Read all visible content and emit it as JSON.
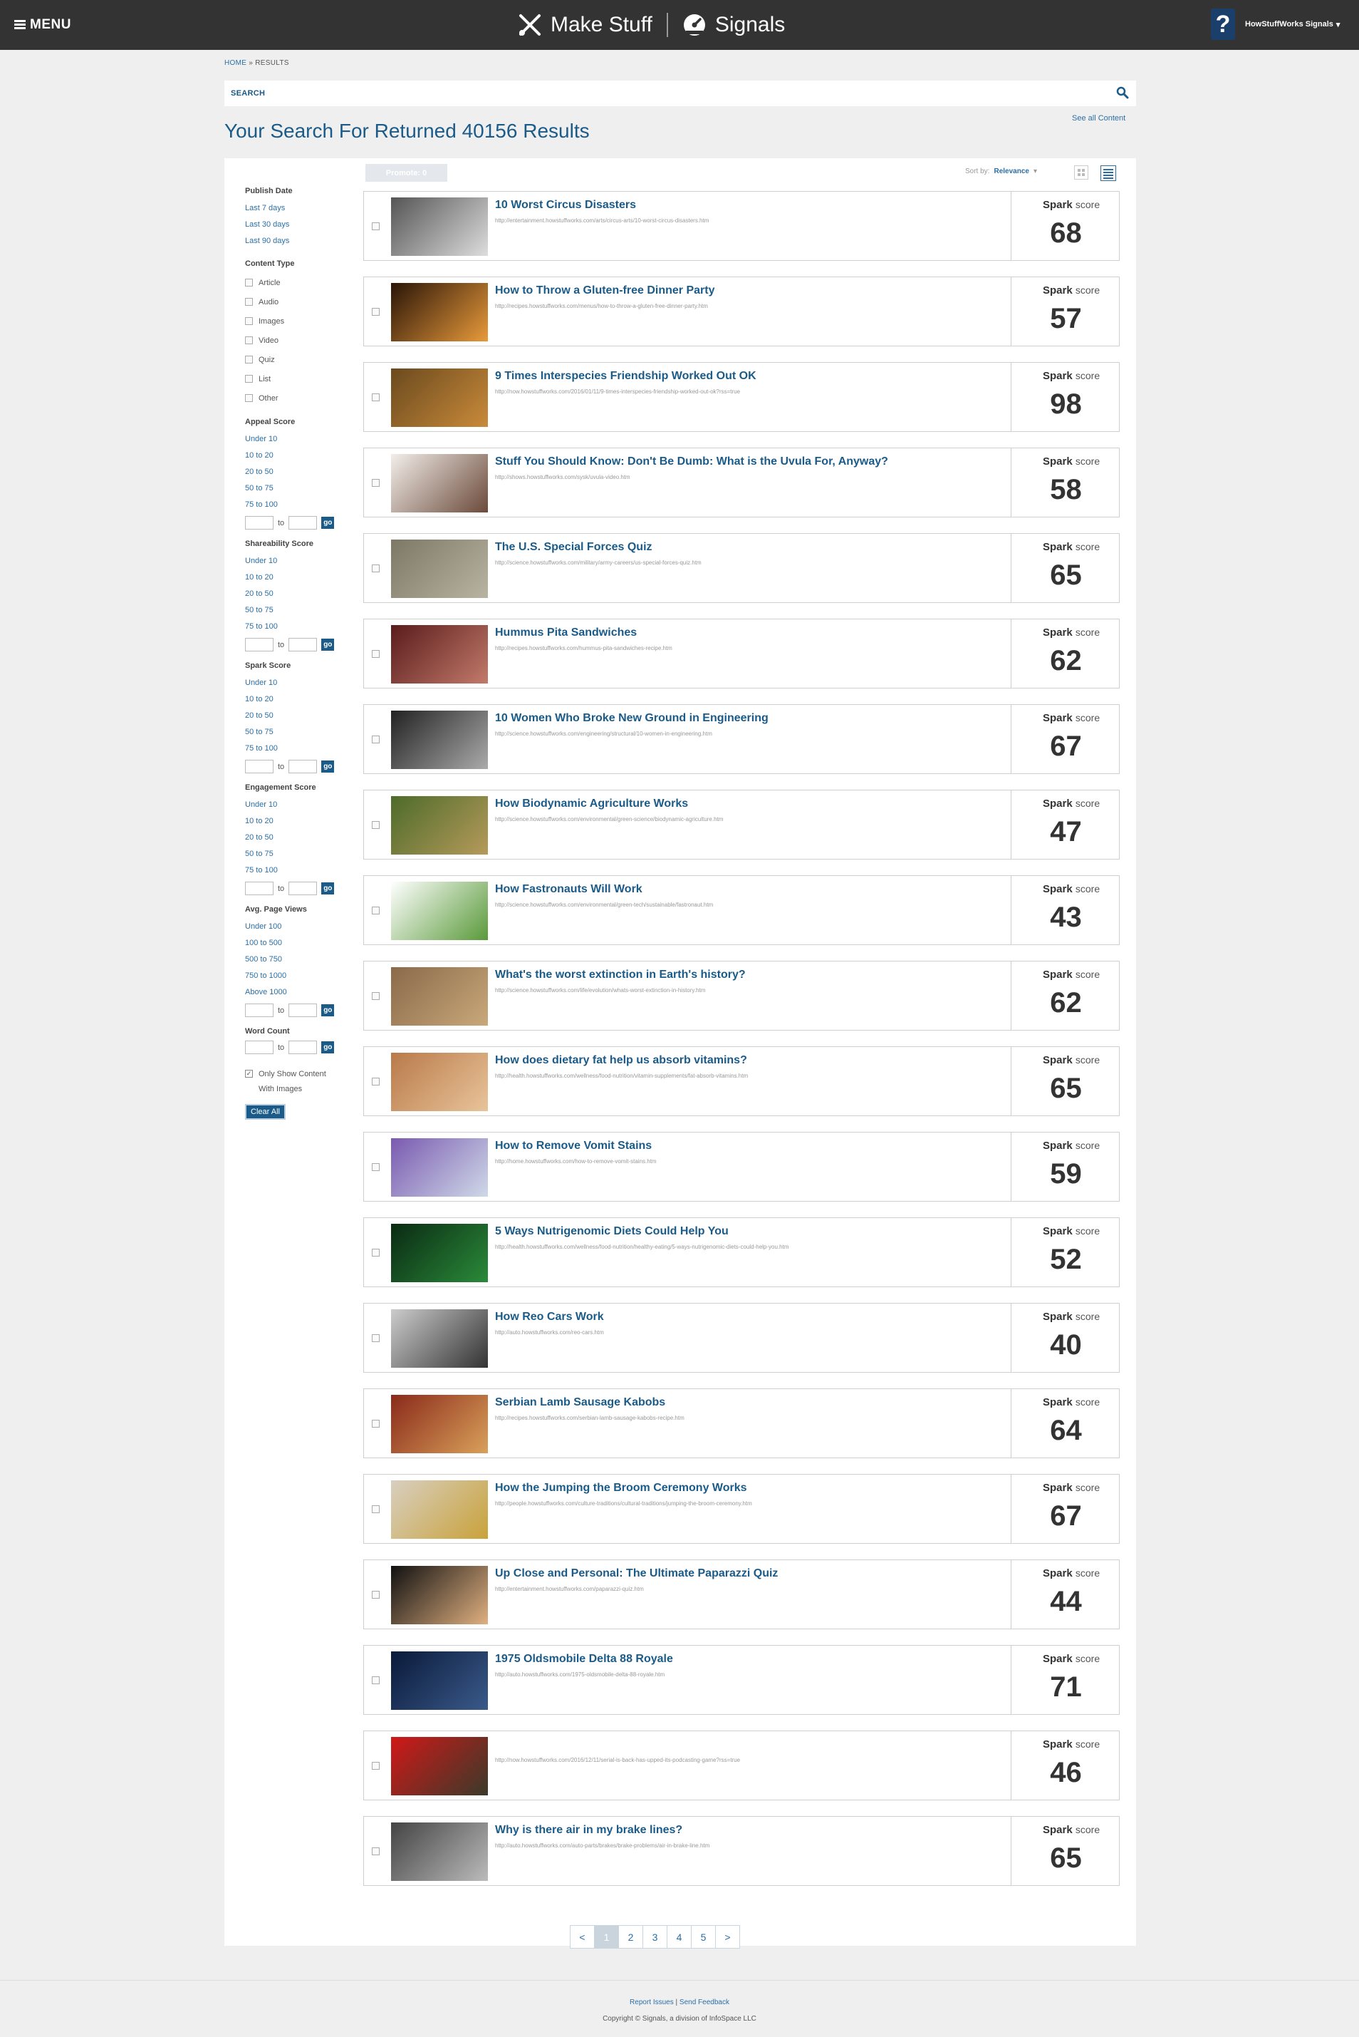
{
  "header": {
    "menu_label": "MENU",
    "brand_left": "Make Stuff",
    "brand_right": "Signals",
    "user_name": "HowStuffWorks Signals"
  },
  "breadcrumb": {
    "home": "HOME",
    "separator": "»",
    "current": "RESULTS"
  },
  "search": {
    "label": "SEARCH"
  },
  "see_all": "See all Content",
  "page_title": "Your Search For Returned 40156 Results",
  "controls": {
    "promote_label": "Promote: 0",
    "sort_label": "Sort by:",
    "sort_value": "Relevance"
  },
  "sidebar": {
    "publish_date": {
      "heading": "Publish Date",
      "options": [
        "Last 7 days",
        "Last 30 days",
        "Last 90 days"
      ]
    },
    "content_type": {
      "heading": "Content Type",
      "options": [
        "Article",
        "Audio",
        "Images",
        "Video",
        "Quiz",
        "List",
        "Other"
      ]
    },
    "appeal": {
      "heading": "Appeal Score",
      "options": [
        "Under 10",
        "10 to 20",
        "20 to 50",
        "50 to 75",
        "75 to 100"
      ]
    },
    "shareability": {
      "heading": "Shareability Score",
      "options": [
        "Under 10",
        "10 to 20",
        "20 to 50",
        "50 to 75",
        "75 to 100"
      ]
    },
    "spark": {
      "heading": "Spark Score",
      "options": [
        "Under 10",
        "10 to 20",
        "20 to 50",
        "50 to 75",
        "75 to 100"
      ]
    },
    "engagement": {
      "heading": "Engagement Score",
      "options": [
        "Under 10",
        "10 to 20",
        "20 to 50",
        "50 to 75",
        "75 to 100"
      ]
    },
    "page_views": {
      "heading": "Avg. Page Views",
      "options": [
        "Under 100",
        "100 to 500",
        "500 to 750",
        "750 to 1000",
        "Above 1000"
      ]
    },
    "word_count": {
      "heading": "Word Count"
    },
    "range_to": "to",
    "range_go": "go",
    "only_images_line1": "Only Show Content",
    "only_images_line2": "With Images",
    "clear_all": "Clear All"
  },
  "spark_word": "Spark",
  "score_word": "score",
  "results": [
    {
      "title": "10 Worst Circus Disasters",
      "url": "http://entertainment.howstuffworks.com/arts/circus-arts/10-worst-circus-disasters.htm",
      "score": "68",
      "thumb": [
        "#555",
        "#ddd"
      ]
    },
    {
      "title": "How to Throw a Gluten-free Dinner Party",
      "url": "http://recipes.howstuffworks.com/menus/how-to-throw-a-gluten-free-dinner-party.htm",
      "score": "57",
      "thumb": [
        "#2a1508",
        "#e89a3a"
      ]
    },
    {
      "title": "9 Times Interspecies Friendship Worked Out OK",
      "url": "http://now.howstuffworks.com/2016/01/11/9-times-interspecies-friendship-worked-out-ok?rss=true",
      "score": "98",
      "thumb": [
        "#6b4a1e",
        "#c98a3a"
      ]
    },
    {
      "title": "Stuff You Should Know: Don't Be Dumb: What is the Uvula For, Anyway?",
      "url": "http://shows.howstuffworks.com/sysk/uvula-video.htm",
      "score": "58",
      "thumb": [
        "#f2eeea",
        "#6b4a3a"
      ]
    },
    {
      "title": "The U.S. Special Forces Quiz",
      "url": "http://science.howstuffworks.com/military/army-careers/us-special-forces-quiz.htm",
      "score": "65",
      "thumb": [
        "#7d7766",
        "#b9b4a2"
      ]
    },
    {
      "title": "Hummus Pita Sandwiches",
      "url": "http://recipes.howstuffworks.com/hummus-pita-sandwiches-recipe.htm",
      "score": "62",
      "thumb": [
        "#5a1c1c",
        "#c27a6a"
      ]
    },
    {
      "title": "10 Women Who Broke New Ground in Engineering",
      "url": "http://science.howstuffworks.com/engineering/structural/10-women-in-engineering.htm",
      "score": "67",
      "thumb": [
        "#222",
        "#aaa"
      ]
    },
    {
      "title": "How Biodynamic Agriculture Works",
      "url": "http://science.howstuffworks.com/environmental/green-science/biodynamic-agriculture.htm",
      "score": "47",
      "thumb": [
        "#4d6b2a",
        "#b59a5a"
      ]
    },
    {
      "title": "How Fastronauts Will Work",
      "url": "http://science.howstuffworks.com/environmental/green-tech/sustainable/fastronaut.htm",
      "score": "43",
      "thumb": [
        "#ffffff",
        "#5a9a3a"
      ]
    },
    {
      "title": "What's the worst extinction in Earth's history?",
      "url": "http://science.howstuffworks.com/life/evolution/whats-worst-extinction-in-history.htm",
      "score": "62",
      "thumb": [
        "#8a6a4a",
        "#c9a87a"
      ]
    },
    {
      "title": "How does dietary fat help us absorb vitamins?",
      "url": "http://health.howstuffworks.com/wellness/food-nutrition/vitamin-supplements/fat-absorb-vitamins.htm",
      "score": "65",
      "thumb": [
        "#b97a4a",
        "#e8c49a"
      ]
    },
    {
      "title": "How to Remove Vomit Stains",
      "url": "http://home.howstuffworks.com/how-to-remove-vomit-stains.htm",
      "score": "59",
      "thumb": [
        "#7a5ab0",
        "#cfd9e8"
      ]
    },
    {
      "title": "5 Ways Nutrigenomic Diets Could Help You",
      "url": "http://health.howstuffworks.com/wellness/food-nutrition/healthy-eating/5-ways-nutrigenomic-diets-could-help-you.htm",
      "score": "52",
      "thumb": [
        "#0a2a12",
        "#2a8a3a"
      ]
    },
    {
      "title": "How Reo Cars Work",
      "url": "http://auto.howstuffworks.com/reo-cars.htm",
      "score": "40",
      "thumb": [
        "#ccc",
        "#333"
      ]
    },
    {
      "title": "Serbian Lamb Sausage Kabobs",
      "url": "http://recipes.howstuffworks.com/serbian-lamb-sausage-kabobs-recipe.htm",
      "score": "64",
      "thumb": [
        "#8a2a1a",
        "#d9a05a"
      ]
    },
    {
      "title": "How the Jumping the Broom Ceremony Works",
      "url": "http://people.howstuffworks.com/culture-traditions/cultural-traditions/jumping-the-broom-ceremony.htm",
      "score": "67",
      "thumb": [
        "#d8cfc0",
        "#c9a23a"
      ]
    },
    {
      "title": "Up Close and Personal: The Ultimate Paparazzi Quiz",
      "url": "http://entertainment.howstuffworks.com/paparazzi-quiz.htm",
      "score": "44",
      "thumb": [
        "#111",
        "#e0b080"
      ]
    },
    {
      "title": "1975 Oldsmobile Delta 88 Royale",
      "url": "http://auto.howstuffworks.com/1975-oldsmobile-delta-88-royale.htm",
      "score": "71",
      "thumb": [
        "#0a1a3a",
        "#3a5a8a"
      ]
    },
    {
      "title": "",
      "url": "http://now.howstuffworks.com/2016/12/11/serial-is-back-has-upped-its-podcasting-game?rss=true",
      "score": "46",
      "thumb": [
        "#d01818",
        "#3a3a2a"
      ]
    },
    {
      "title": "Why is there air in my brake lines?",
      "url": "http://auto.howstuffworks.com/auto-parts/brakes/brake-problems/air-in-brake-line.htm",
      "score": "65",
      "thumb": [
        "#444",
        "#bbb"
      ]
    }
  ],
  "pagination": {
    "prev": "<",
    "pages": [
      "1",
      "2",
      "3",
      "4",
      "5"
    ],
    "next": ">",
    "current": "1"
  },
  "footer": {
    "report": "Report Issues",
    "separator": "|",
    "feedback": "Send Feedback",
    "copyright": "Copyright © Signals, a division of InfoSpace LLC"
  }
}
